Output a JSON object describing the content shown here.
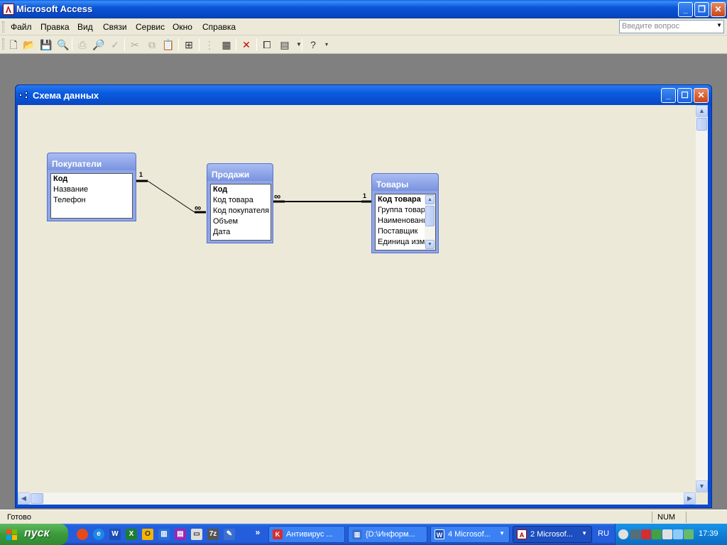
{
  "app": {
    "title": "Microsoft Access"
  },
  "menu": {
    "items": [
      "Файл",
      "Правка",
      "Вид",
      "Связи",
      "Сервис",
      "Окно",
      "Справка"
    ],
    "help_placeholder": "Введите вопрос"
  },
  "window": {
    "title": "Схема данных"
  },
  "tables": [
    {
      "name": "Покупатели",
      "fields": [
        "Код",
        "Название",
        "Телефон"
      ],
      "key_field": "Код"
    },
    {
      "name": "Продажи",
      "fields": [
        "Код",
        "Код товара",
        "Код покупателя",
        "Объем",
        "Дата"
      ],
      "key_field": "Код"
    },
    {
      "name": "Товары",
      "fields": [
        "Код товара",
        "Группа товар",
        "Наименовани",
        "Поставщик",
        "Единица изме"
      ],
      "key_field": "Код товара"
    }
  ],
  "relationships": [
    {
      "from_table": "Покупатели",
      "from_field": "Код",
      "to_table": "Продажи",
      "to_field": "Код покупателя",
      "one_label": "1",
      "many_label": "∞"
    },
    {
      "from_table": "Товары",
      "from_field": "Код товара",
      "to_table": "Продажи",
      "to_field": "Код товара",
      "one_label": "1",
      "many_label": "∞"
    }
  ],
  "status": {
    "text": "Готово",
    "num": "NUM"
  },
  "taskbar": {
    "start_label": "пуск",
    "tasks": [
      {
        "label": "Антивирус ...",
        "icon": "kaspersky-icon",
        "active": false
      },
      {
        "label": "{D:\\Информ...",
        "icon": "folder-icon",
        "active": false
      },
      {
        "label": "4 Microsof...",
        "icon": "word-icon",
        "active": false
      },
      {
        "label": "2 Microsof...",
        "icon": "access-icon",
        "active": true
      }
    ],
    "lang": "RU",
    "clock": "17:39"
  },
  "colors": {
    "title_bar": "#0a56d8",
    "table_header": "#8ea5e8",
    "canvas_bg": "#ece9d8",
    "start_button": "#3c9a3c"
  }
}
